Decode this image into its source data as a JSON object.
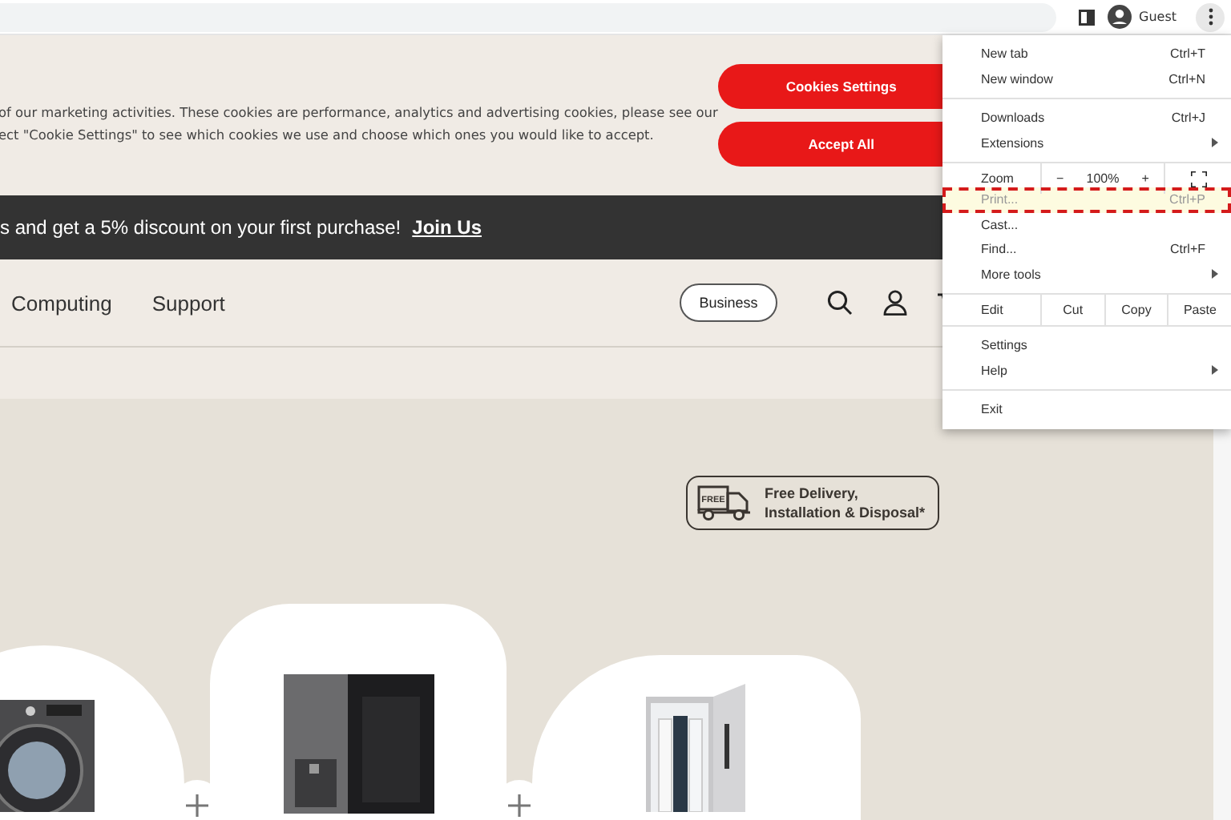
{
  "browser": {
    "profile": "Guest"
  },
  "cookie_banner": {
    "lines": [
      "of our marketing activities. These cookies are performance, analytics and advertising cookies, please see our",
      "ect \"Cookie Settings\" to see which cookies we use and choose which ones you would like to accept."
    ],
    "buttons": [
      "Cookies Settings",
      "Accept All"
    ]
  },
  "promo_bar": {
    "text": "s and get a 5% discount on your first purchase!",
    "link": "Join Us"
  },
  "nav": {
    "items": [
      "Computing",
      "Support"
    ],
    "business_button": "Business"
  },
  "delivery_badge": {
    "lines": [
      "Free Delivery,",
      "Installation & Disposal*"
    ],
    "truck_label": "FREE"
  },
  "products": [
    {
      "kind": "washer"
    },
    {
      "kind": "fridge"
    },
    {
      "kind": "styler"
    }
  ],
  "menu": [
    {
      "kind": "item",
      "label": "New tab",
      "shortcut": "Ctrl+T",
      "submenu": false,
      "highlighted": false
    },
    {
      "kind": "item",
      "label": "New window",
      "shortcut": "Ctrl+N",
      "submenu": false,
      "highlighted": false
    },
    {
      "kind": "separator"
    },
    {
      "kind": "item",
      "label": "Downloads",
      "shortcut": "Ctrl+J",
      "submenu": false,
      "highlighted": false
    },
    {
      "kind": "item",
      "label": "Extensions",
      "submenu": true,
      "highlighted": false
    },
    {
      "kind": "separator"
    },
    {
      "kind": "zoom",
      "label": "Zoom",
      "minus": "−",
      "value": "100%",
      "plus": "+"
    },
    {
      "kind": "item",
      "label": "Print...",
      "shortcut": "Ctrl+P",
      "submenu": false,
      "highlighted": true
    },
    {
      "kind": "item",
      "label": "Cast...",
      "submenu": false,
      "highlighted": false
    },
    {
      "kind": "item",
      "label": "Find...",
      "shortcut": "Ctrl+F",
      "submenu": false,
      "highlighted": false
    },
    {
      "kind": "item",
      "label": "More tools",
      "submenu": true,
      "highlighted": false
    },
    {
      "kind": "separator"
    },
    {
      "kind": "edit",
      "label": "Edit",
      "actions": [
        "Cut",
        "Copy",
        "Paste"
      ]
    },
    {
      "kind": "separator"
    },
    {
      "kind": "item",
      "label": "Settings",
      "submenu": false,
      "highlighted": false
    },
    {
      "kind": "item",
      "label": "Help",
      "submenu": true,
      "highlighted": false
    },
    {
      "kind": "separator"
    },
    {
      "kind": "item",
      "label": "Exit",
      "submenu": false,
      "highlighted": false
    }
  ]
}
